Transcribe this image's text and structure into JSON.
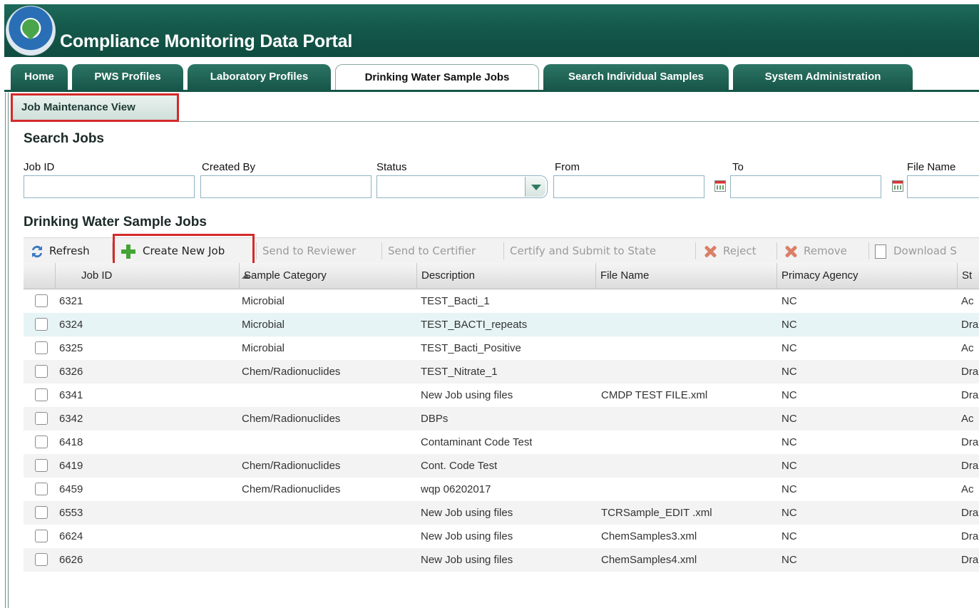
{
  "app": {
    "title": "Compliance Monitoring Data Portal",
    "logo": "epa-seal"
  },
  "tabs": [
    {
      "label": "Home",
      "active": false
    },
    {
      "label": "PWS Profiles",
      "active": false
    },
    {
      "label": "Laboratory Profiles",
      "active": false
    },
    {
      "label": "Drinking Water Sample Jobs",
      "active": true
    },
    {
      "label": "Search Individual Samples",
      "active": false
    },
    {
      "label": "System Administration",
      "active": false
    }
  ],
  "subtab": {
    "label": "Job Maintenance View"
  },
  "search": {
    "title": "Search Jobs",
    "fields": {
      "job_id": {
        "label": "Job ID",
        "value": ""
      },
      "created_by": {
        "label": "Created By",
        "value": ""
      },
      "status": {
        "label": "Status",
        "value": ""
      },
      "from": {
        "label": "From",
        "value": ""
      },
      "to": {
        "label": "To",
        "value": ""
      },
      "file_name": {
        "label": "File Name",
        "value": ""
      }
    }
  },
  "jobs": {
    "title": "Drinking Water Sample Jobs",
    "toolbar": {
      "refresh": "Refresh",
      "create": "Create New Job",
      "send_reviewer": "Send to Reviewer",
      "send_certifier": "Send to Certifier",
      "certify_submit": "Certify and Submit to State",
      "reject": "Reject",
      "remove": "Remove",
      "download": "Download S"
    },
    "columns": {
      "job_id": "Job ID",
      "category": "Sample Category",
      "description": "Description",
      "file_name": "File Name",
      "agency": "Primacy Agency",
      "status": "St"
    },
    "rows": [
      {
        "id": "6321",
        "category": "Microbial",
        "description": "TEST_Bacti_1",
        "file": "",
        "agency": "NC",
        "status": "Ac"
      },
      {
        "id": "6324",
        "category": "Microbial",
        "description": "TEST_BACTI_repeats",
        "file": "",
        "agency": "NC",
        "status": "Dra"
      },
      {
        "id": "6325",
        "category": "Microbial",
        "description": "TEST_Bacti_Positive",
        "file": "",
        "agency": "NC",
        "status": "Ac"
      },
      {
        "id": "6326",
        "category": "Chem/Radionuclides",
        "description": "TEST_Nitrate_1",
        "file": "",
        "agency": "NC",
        "status": "Dra"
      },
      {
        "id": "6341",
        "category": "",
        "description": "New Job using files",
        "file": "CMDP TEST FILE.xml",
        "agency": "NC",
        "status": "Dra"
      },
      {
        "id": "6342",
        "category": "Chem/Radionuclides",
        "description": "DBPs",
        "file": "",
        "agency": "NC",
        "status": "Ac"
      },
      {
        "id": "6418",
        "category": "",
        "description": "Contaminant Code Test",
        "file": "",
        "agency": "NC",
        "status": "Dra"
      },
      {
        "id": "6419",
        "category": "Chem/Radionuclides",
        "description": "Cont. Code Test",
        "file": "",
        "agency": "NC",
        "status": "Dra"
      },
      {
        "id": "6459",
        "category": "Chem/Radionuclides",
        "description": "wqp 06202017",
        "file": "",
        "agency": "NC",
        "status": "Ac"
      },
      {
        "id": "6553",
        "category": "",
        "description": "New Job using files",
        "file": "TCRSample_EDIT .xml",
        "agency": "NC",
        "status": "Dra"
      },
      {
        "id": "6624",
        "category": "",
        "description": "New Job using files",
        "file": "ChemSamples3.xml",
        "agency": "NC",
        "status": "Dra"
      },
      {
        "id": "6626",
        "category": "",
        "description": "New Job using files",
        "file": "ChemSamples4.xml",
        "agency": "NC",
        "status": "Dra"
      }
    ]
  }
}
